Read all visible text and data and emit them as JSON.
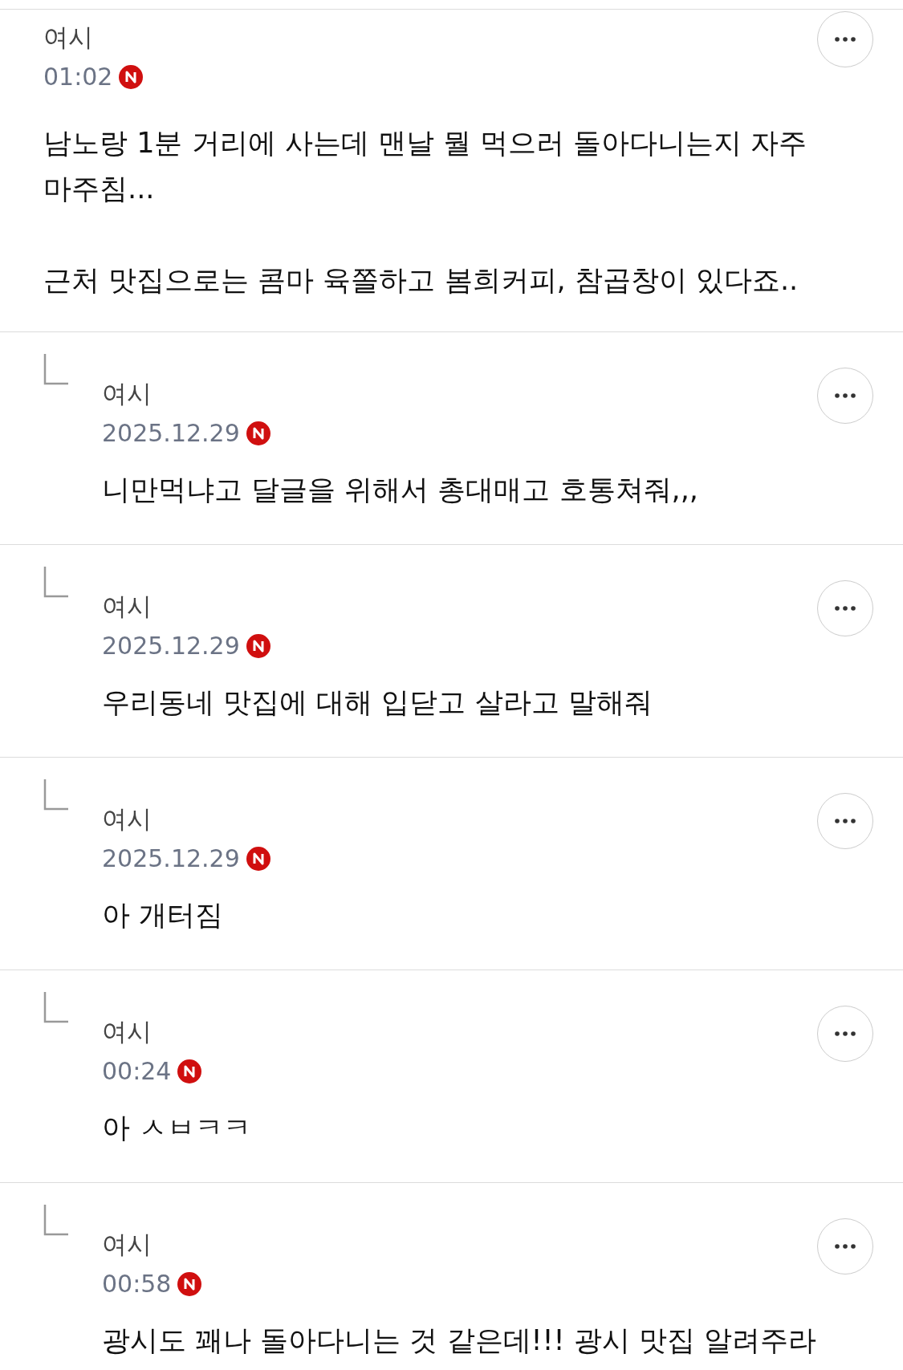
{
  "comments": [
    {
      "kind": "comment",
      "author": "여시",
      "time": "01:02",
      "text": "남노랑 1분 거리에 사는데 맨날 뭘 먹으러 돌아다니는지 자주 마주침...\n\n근처 맛집으로는 콤마 육쫄하고 봄희커피, 참곱창이 있다죠.."
    },
    {
      "kind": "reply",
      "author": "여시",
      "time": "2025.12.29",
      "text": "니만먹냐고 달글을 위해서 총대매고 호통쳐줘,,,"
    },
    {
      "kind": "reply",
      "author": "여시",
      "time": "2025.12.29",
      "text": "우리동네 맛집에 대해 입닫고 살라고 말해줘"
    },
    {
      "kind": "reply",
      "author": "여시",
      "time": "2025.12.29",
      "text": "아 개터짐"
    },
    {
      "kind": "reply",
      "author": "여시",
      "time": "00:24",
      "text": "아 ㅅㅂㅋㅋ"
    },
    {
      "kind": "reply",
      "author": "여시",
      "time": "00:58",
      "text": "광시도 꽤나 돌아다니는 것 같은데!!! 광시 맛집 알려주라"
    }
  ]
}
